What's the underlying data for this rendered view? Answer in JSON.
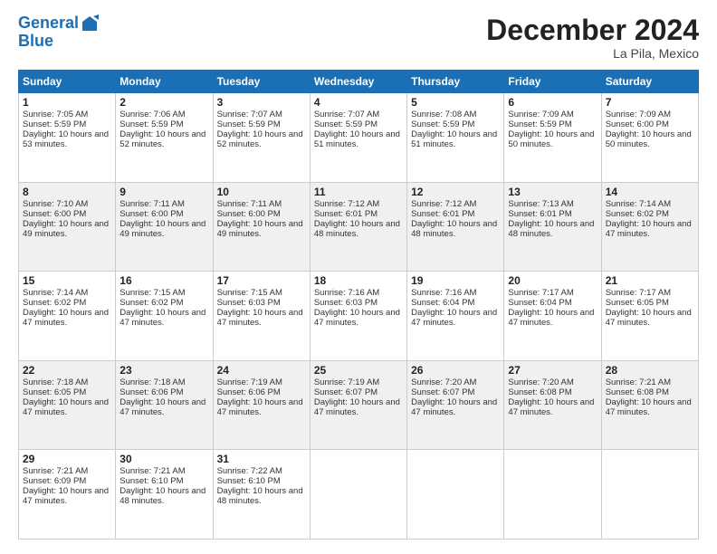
{
  "header": {
    "logo_line1": "General",
    "logo_line2": "Blue",
    "month_title": "December 2024",
    "location": "La Pila, Mexico"
  },
  "days_of_week": [
    "Sunday",
    "Monday",
    "Tuesday",
    "Wednesday",
    "Thursday",
    "Friday",
    "Saturday"
  ],
  "weeks": [
    [
      {
        "day": "1",
        "sunrise": "Sunrise: 7:05 AM",
        "sunset": "Sunset: 5:59 PM",
        "daylight": "Daylight: 10 hours and 53 minutes."
      },
      {
        "day": "2",
        "sunrise": "Sunrise: 7:06 AM",
        "sunset": "Sunset: 5:59 PM",
        "daylight": "Daylight: 10 hours and 52 minutes."
      },
      {
        "day": "3",
        "sunrise": "Sunrise: 7:07 AM",
        "sunset": "Sunset: 5:59 PM",
        "daylight": "Daylight: 10 hours and 52 minutes."
      },
      {
        "day": "4",
        "sunrise": "Sunrise: 7:07 AM",
        "sunset": "Sunset: 5:59 PM",
        "daylight": "Daylight: 10 hours and 51 minutes."
      },
      {
        "day": "5",
        "sunrise": "Sunrise: 7:08 AM",
        "sunset": "Sunset: 5:59 PM",
        "daylight": "Daylight: 10 hours and 51 minutes."
      },
      {
        "day": "6",
        "sunrise": "Sunrise: 7:09 AM",
        "sunset": "Sunset: 5:59 PM",
        "daylight": "Daylight: 10 hours and 50 minutes."
      },
      {
        "day": "7",
        "sunrise": "Sunrise: 7:09 AM",
        "sunset": "Sunset: 6:00 PM",
        "daylight": "Daylight: 10 hours and 50 minutes."
      }
    ],
    [
      {
        "day": "8",
        "sunrise": "Sunrise: 7:10 AM",
        "sunset": "Sunset: 6:00 PM",
        "daylight": "Daylight: 10 hours and 49 minutes."
      },
      {
        "day": "9",
        "sunrise": "Sunrise: 7:11 AM",
        "sunset": "Sunset: 6:00 PM",
        "daylight": "Daylight: 10 hours and 49 minutes."
      },
      {
        "day": "10",
        "sunrise": "Sunrise: 7:11 AM",
        "sunset": "Sunset: 6:00 PM",
        "daylight": "Daylight: 10 hours and 49 minutes."
      },
      {
        "day": "11",
        "sunrise": "Sunrise: 7:12 AM",
        "sunset": "Sunset: 6:01 PM",
        "daylight": "Daylight: 10 hours and 48 minutes."
      },
      {
        "day": "12",
        "sunrise": "Sunrise: 7:12 AM",
        "sunset": "Sunset: 6:01 PM",
        "daylight": "Daylight: 10 hours and 48 minutes."
      },
      {
        "day": "13",
        "sunrise": "Sunrise: 7:13 AM",
        "sunset": "Sunset: 6:01 PM",
        "daylight": "Daylight: 10 hours and 48 minutes."
      },
      {
        "day": "14",
        "sunrise": "Sunrise: 7:14 AM",
        "sunset": "Sunset: 6:02 PM",
        "daylight": "Daylight: 10 hours and 47 minutes."
      }
    ],
    [
      {
        "day": "15",
        "sunrise": "Sunrise: 7:14 AM",
        "sunset": "Sunset: 6:02 PM",
        "daylight": "Daylight: 10 hours and 47 minutes."
      },
      {
        "day": "16",
        "sunrise": "Sunrise: 7:15 AM",
        "sunset": "Sunset: 6:02 PM",
        "daylight": "Daylight: 10 hours and 47 minutes."
      },
      {
        "day": "17",
        "sunrise": "Sunrise: 7:15 AM",
        "sunset": "Sunset: 6:03 PM",
        "daylight": "Daylight: 10 hours and 47 minutes."
      },
      {
        "day": "18",
        "sunrise": "Sunrise: 7:16 AM",
        "sunset": "Sunset: 6:03 PM",
        "daylight": "Daylight: 10 hours and 47 minutes."
      },
      {
        "day": "19",
        "sunrise": "Sunrise: 7:16 AM",
        "sunset": "Sunset: 6:04 PM",
        "daylight": "Daylight: 10 hours and 47 minutes."
      },
      {
        "day": "20",
        "sunrise": "Sunrise: 7:17 AM",
        "sunset": "Sunset: 6:04 PM",
        "daylight": "Daylight: 10 hours and 47 minutes."
      },
      {
        "day": "21",
        "sunrise": "Sunrise: 7:17 AM",
        "sunset": "Sunset: 6:05 PM",
        "daylight": "Daylight: 10 hours and 47 minutes."
      }
    ],
    [
      {
        "day": "22",
        "sunrise": "Sunrise: 7:18 AM",
        "sunset": "Sunset: 6:05 PM",
        "daylight": "Daylight: 10 hours and 47 minutes."
      },
      {
        "day": "23",
        "sunrise": "Sunrise: 7:18 AM",
        "sunset": "Sunset: 6:06 PM",
        "daylight": "Daylight: 10 hours and 47 minutes."
      },
      {
        "day": "24",
        "sunrise": "Sunrise: 7:19 AM",
        "sunset": "Sunset: 6:06 PM",
        "daylight": "Daylight: 10 hours and 47 minutes."
      },
      {
        "day": "25",
        "sunrise": "Sunrise: 7:19 AM",
        "sunset": "Sunset: 6:07 PM",
        "daylight": "Daylight: 10 hours and 47 minutes."
      },
      {
        "day": "26",
        "sunrise": "Sunrise: 7:20 AM",
        "sunset": "Sunset: 6:07 PM",
        "daylight": "Daylight: 10 hours and 47 minutes."
      },
      {
        "day": "27",
        "sunrise": "Sunrise: 7:20 AM",
        "sunset": "Sunset: 6:08 PM",
        "daylight": "Daylight: 10 hours and 47 minutes."
      },
      {
        "day": "28",
        "sunrise": "Sunrise: 7:21 AM",
        "sunset": "Sunset: 6:08 PM",
        "daylight": "Daylight: 10 hours and 47 minutes."
      }
    ],
    [
      {
        "day": "29",
        "sunrise": "Sunrise: 7:21 AM",
        "sunset": "Sunset: 6:09 PM",
        "daylight": "Daylight: 10 hours and 47 minutes."
      },
      {
        "day": "30",
        "sunrise": "Sunrise: 7:21 AM",
        "sunset": "Sunset: 6:10 PM",
        "daylight": "Daylight: 10 hours and 48 minutes."
      },
      {
        "day": "31",
        "sunrise": "Sunrise: 7:22 AM",
        "sunset": "Sunset: 6:10 PM",
        "daylight": "Daylight: 10 hours and 48 minutes."
      },
      null,
      null,
      null,
      null
    ]
  ]
}
